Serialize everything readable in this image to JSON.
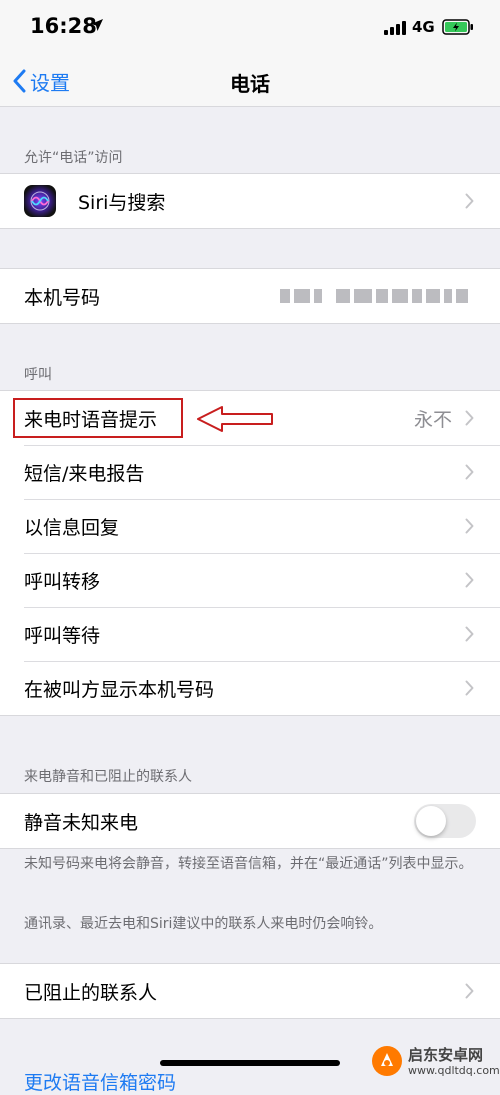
{
  "status_bar": {
    "time": "16:28",
    "network": "4G"
  },
  "nav": {
    "back_label": "设置",
    "title": "电话"
  },
  "sections": {
    "allow_access": {
      "header": "允许“电话”访问",
      "siri_label": "Siri与搜索"
    },
    "my_number": {
      "label": "本机号码"
    },
    "calls": {
      "header": "呼叫",
      "items": [
        {
          "label": "来电时语音提示",
          "value": "永不"
        },
        {
          "label": "短信/来电报告"
        },
        {
          "label": "以信息回复"
        },
        {
          "label": "呼叫转移"
        },
        {
          "label": "呼叫等待"
        },
        {
          "label": "在被叫方显示本机号码"
        }
      ]
    },
    "silence": {
      "header": "来电静音和已阻止的联系人",
      "toggle_label": "静音未知来电",
      "toggle_on": false,
      "note1": "未知号码来电将会静音，转接至语音信箱，并在“最近通话”列表中显示。",
      "note2": "通讯录、最近去电和Siri建议中的联系人来电时仍会响铃。"
    },
    "blocked": {
      "label": "已阻止的联系人"
    },
    "cut_off": {
      "label": "更改语音信箱密码"
    }
  },
  "watermark": {
    "name": "启东安卓网",
    "url": "www.qdltdq.com"
  },
  "colors": {
    "accent": "#1e7bf2",
    "annotation": "#c81e1e",
    "background": "#efeff4"
  }
}
